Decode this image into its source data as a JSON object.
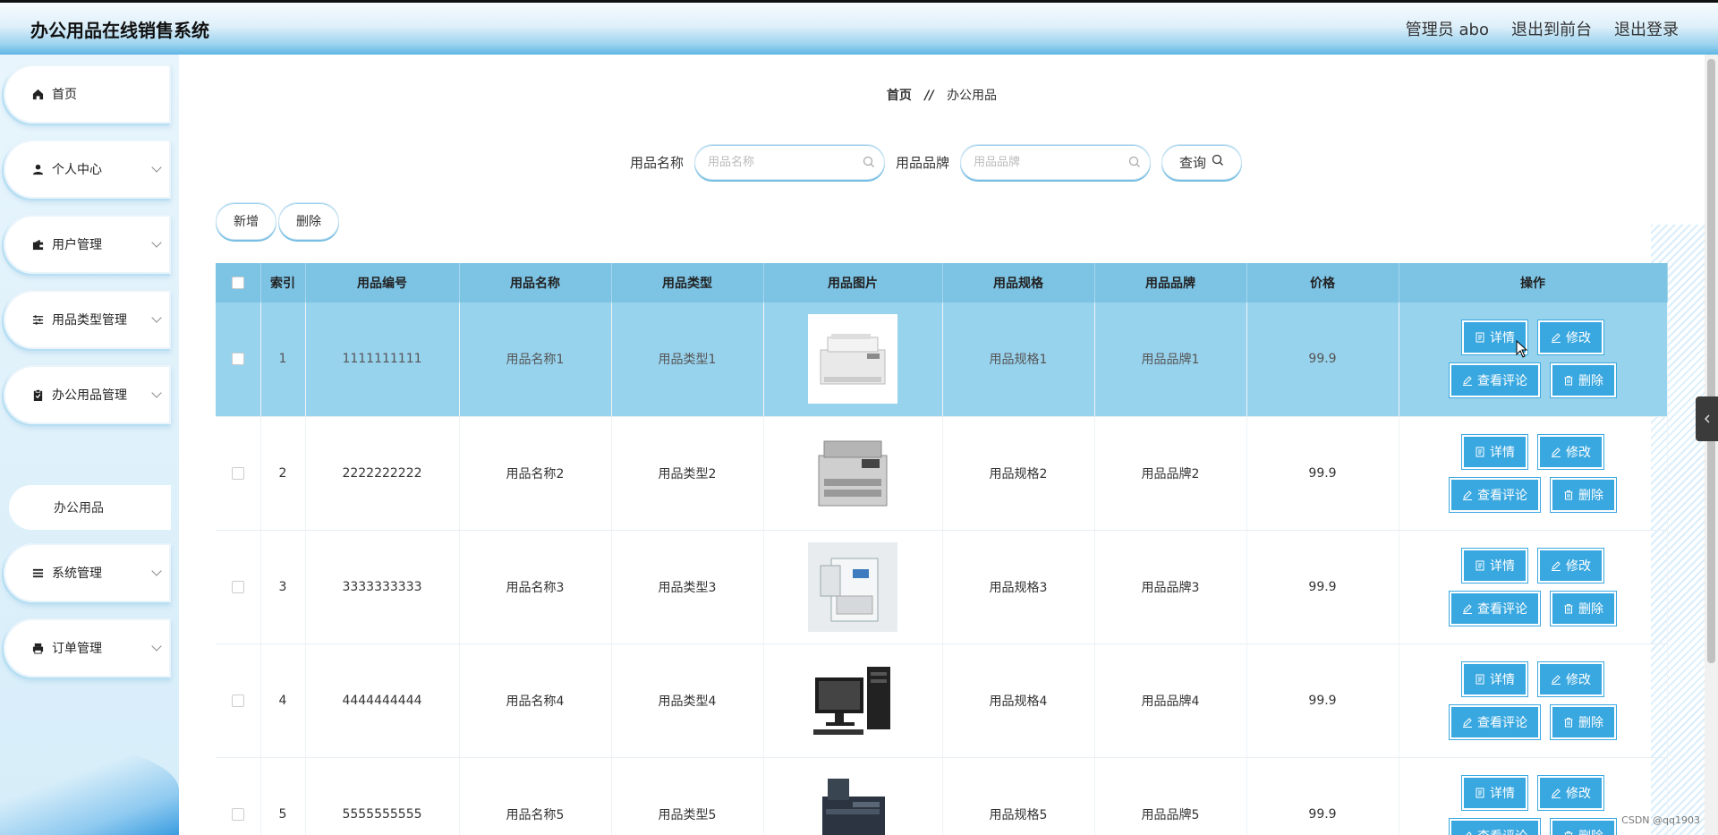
{
  "header": {
    "title": "办公用品在线销售系统",
    "user": "管理员 abo",
    "to_front": "退出到前台",
    "logout": "退出登录"
  },
  "sidebar": {
    "items": [
      {
        "label": "首页",
        "icon": "home-icon",
        "has_children": false
      },
      {
        "label": "个人中心",
        "icon": "person-icon",
        "has_children": true
      },
      {
        "label": "用户管理",
        "icon": "wallet-icon",
        "has_children": true
      },
      {
        "label": "用品类型管理",
        "icon": "sliders-icon",
        "has_children": true
      },
      {
        "label": "办公用品管理",
        "icon": "clipboard-icon",
        "has_children": true
      },
      {
        "label": "系统管理",
        "icon": "list-icon",
        "has_children": true
      },
      {
        "label": "订单管理",
        "icon": "printer-icon",
        "has_children": true
      }
    ],
    "submenu_label": "办公用品"
  },
  "breadcrumb": {
    "home": "首页",
    "separator": "//",
    "current": "办公用品"
  },
  "search": {
    "name_label": "用品名称",
    "name_placeholder": "用品名称",
    "brand_label": "用品品牌",
    "brand_placeholder": "用品品牌",
    "query_label": "查询"
  },
  "actions": {
    "add_label": "新增",
    "delete_label": "删除"
  },
  "table": {
    "columns": [
      "索引",
      "用品编号",
      "用品名称",
      "用品类型",
      "用品图片",
      "用品规格",
      "用品品牌",
      "价格",
      "操作"
    ],
    "op_labels": {
      "detail": "详情",
      "edit": "修改",
      "comments": "查看评论",
      "delete": "删除"
    },
    "rows": [
      {
        "index": "1",
        "code": "1111111111",
        "name": "用品名称1",
        "type": "用品类型1",
        "image": "copier-white",
        "spec": "用品规格1",
        "brand": "用品品牌1",
        "price": "99.9"
      },
      {
        "index": "2",
        "code": "2222222222",
        "name": "用品名称2",
        "type": "用品类型2",
        "image": "copier-grey",
        "spec": "用品规格2",
        "brand": "用品品牌2",
        "price": "99.9"
      },
      {
        "index": "3",
        "code": "3333333333",
        "name": "用品名称3",
        "type": "用品类型3",
        "image": "copier-large",
        "spec": "用品规格3",
        "brand": "用品品牌3",
        "price": "99.9"
      },
      {
        "index": "4",
        "code": "4444444444",
        "name": "用品名称4",
        "type": "用品类型4",
        "image": "desktop-computer",
        "spec": "用品规格4",
        "brand": "用品品牌4",
        "price": "99.9"
      },
      {
        "index": "5",
        "code": "5555555555",
        "name": "用品名称5",
        "type": "用品类型5",
        "image": "copier-dark",
        "spec": "用品规格5",
        "brand": "用品品牌5",
        "price": "99.9"
      }
    ]
  },
  "watermark": "CSDN @qq1903",
  "colors": {
    "accent": "#3aa8e0",
    "table_header": "#7cc3e4",
    "active_row": "#98d3ee"
  }
}
